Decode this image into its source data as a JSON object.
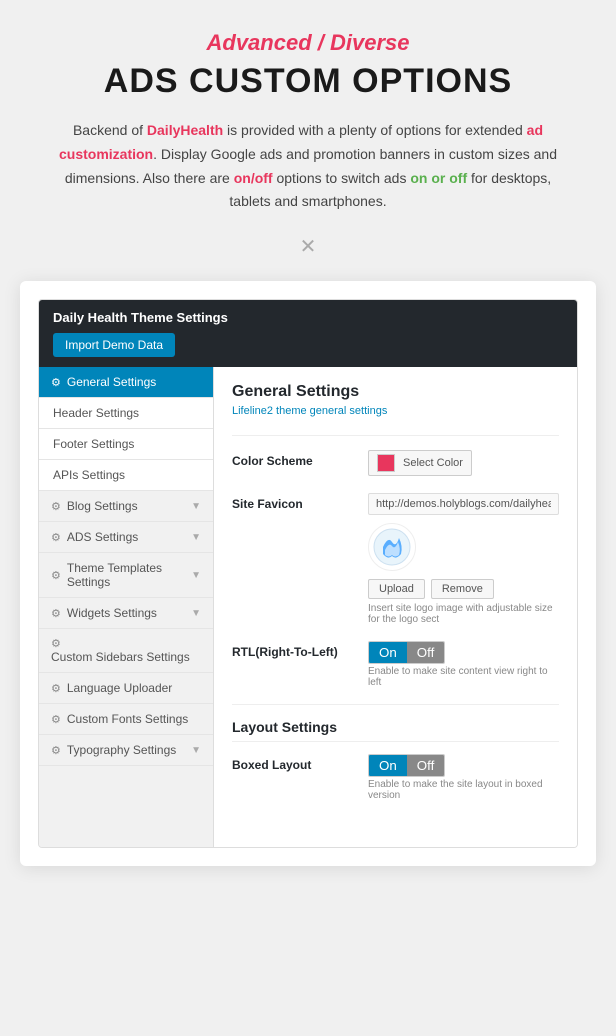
{
  "header": {
    "subtitle": "Advanced / Diverse",
    "main_title": "ADS CUSTOM OPTIONS",
    "description_parts": {
      "before_brand": "Backend of ",
      "brand": "DailyHealth",
      "after_brand": " is provided with a plenty of options for extended ",
      "highlight1": "ad customization",
      "middle": ". Display Google ads and promotion banners in custom sizes and dimensions. Also there are ",
      "highlight2": "on/off",
      "end1": " options to switch ads ",
      "highlight3": "on or off",
      "end2": " for desktops, tablets and smartphones."
    }
  },
  "divider": "✕",
  "browser": {
    "topbar_title": "Daily Health Theme Settings",
    "import_btn": "Import Demo Data",
    "sidebar": {
      "items": [
        {
          "id": "general-settings",
          "label": "General Settings",
          "icon": "gear",
          "active": true,
          "sub": false,
          "chevron": false
        },
        {
          "id": "header-settings",
          "label": "Header Settings",
          "icon": null,
          "active": false,
          "sub": true,
          "chevron": false
        },
        {
          "id": "footer-settings",
          "label": "Footer Settings",
          "icon": null,
          "active": false,
          "sub": true,
          "chevron": false
        },
        {
          "id": "apis-settings",
          "label": "APIs Settings",
          "icon": null,
          "active": false,
          "sub": true,
          "chevron": false
        },
        {
          "id": "blog-settings",
          "label": "Blog Settings",
          "icon": "gear",
          "active": false,
          "sub": false,
          "chevron": true
        },
        {
          "id": "ads-settings",
          "label": "ADS Settings",
          "icon": "gear",
          "active": false,
          "sub": false,
          "chevron": true
        },
        {
          "id": "theme-templates",
          "label": "Theme Templates Settings",
          "icon": "gear",
          "active": false,
          "sub": false,
          "chevron": true
        },
        {
          "id": "widgets-settings",
          "label": "Widgets Settings",
          "icon": "gear",
          "active": false,
          "sub": false,
          "chevron": true
        },
        {
          "id": "custom-sidebars",
          "label": "Custom Sidebars Settings",
          "icon": "gear",
          "active": false,
          "sub": false,
          "chevron": false
        },
        {
          "id": "language-uploader",
          "label": "Language Uploader",
          "icon": "gear",
          "active": false,
          "sub": false,
          "chevron": false
        },
        {
          "id": "custom-fonts",
          "label": "Custom Fonts Settings",
          "icon": "gear",
          "active": false,
          "sub": false,
          "chevron": false
        },
        {
          "id": "typography",
          "label": "Typography Settings",
          "icon": "gear",
          "active": false,
          "sub": false,
          "chevron": true
        }
      ]
    },
    "main": {
      "settings_title": "General Settings",
      "settings_subtitle": "Lifeline2 theme general settings",
      "color_scheme_label": "Color Scheme",
      "color_scheme_btn": "Select Color",
      "site_favicon_label": "Site Favicon",
      "favicon_url": "http://demos.holyblogs.com/dailyhealth/wp-content/up",
      "upload_btn": "Upload",
      "remove_btn": "Remove",
      "favicon_hint": "Insert site logo image with adjustable size for the logo sect",
      "rtl_label": "RTL(Right-To-Left)",
      "rtl_on": "On",
      "rtl_off": "Off",
      "rtl_hint": "Enable to make site content view right to left",
      "layout_section": "Layout Settings",
      "boxed_layout_label": "Boxed Layout",
      "boxed_on": "On",
      "boxed_off": "Off",
      "boxed_hint": "Enable to make the site layout in boxed version"
    }
  }
}
